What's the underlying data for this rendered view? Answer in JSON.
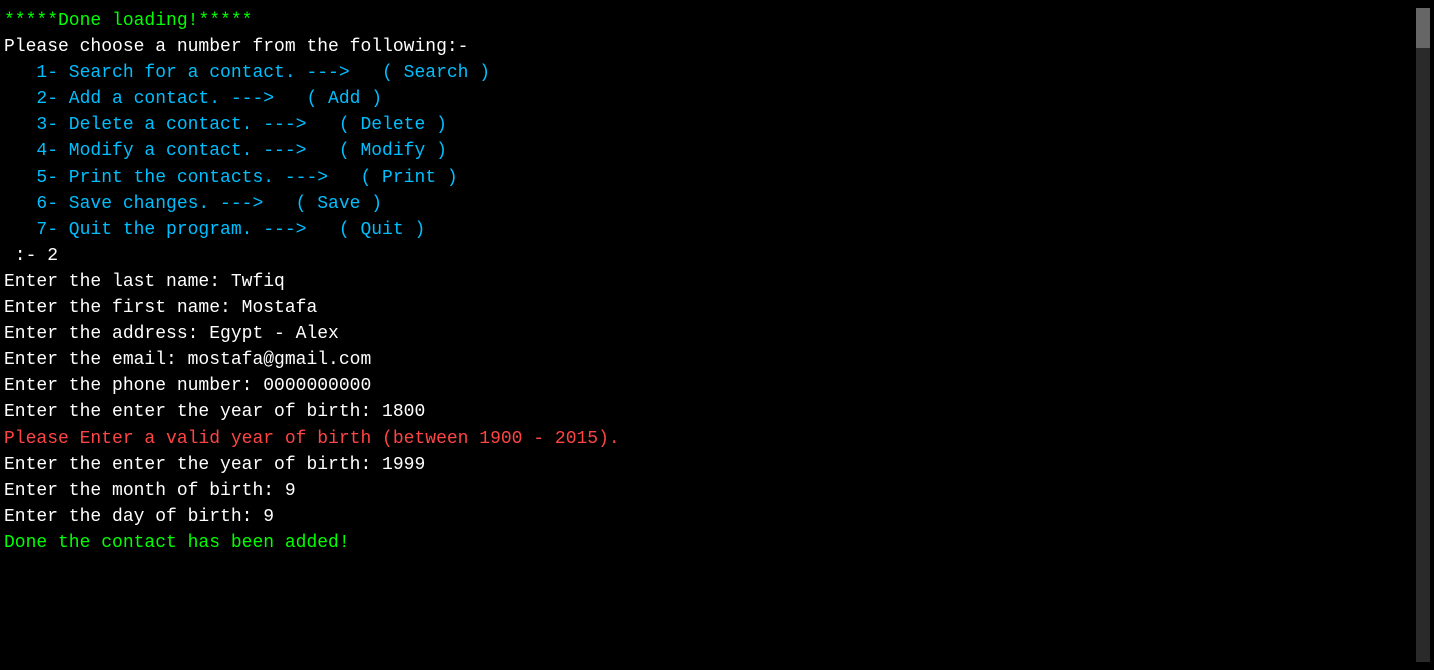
{
  "terminal": {
    "lines": [
      {
        "text": "*****Done loading!*****",
        "color": "green"
      },
      {
        "text": "Please choose a number from the following:-",
        "color": "white"
      },
      {
        "text": "   1- Search for a contact. --->   ( Search )",
        "color": "blue"
      },
      {
        "text": "   2- Add a contact. --->   ( Add )",
        "color": "blue"
      },
      {
        "text": "   3- Delete a contact. --->   ( Delete )",
        "color": "blue"
      },
      {
        "text": "   4- Modify a contact. --->   ( Modify )",
        "color": "blue"
      },
      {
        "text": "   5- Print the contacts. --->   ( Print )",
        "color": "blue"
      },
      {
        "text": "   6- Save changes. --->   ( Save )",
        "color": "blue"
      },
      {
        "text": "   7- Quit the program. --->   ( Quit )",
        "color": "blue"
      },
      {
        "text": "",
        "color": "white"
      },
      {
        "text": " :- 2",
        "color": "white"
      },
      {
        "text": "Enter the last name: Twfiq",
        "color": "white"
      },
      {
        "text": "Enter the first name: Mostafa",
        "color": "white"
      },
      {
        "text": "Enter the address: Egypt - Alex",
        "color": "white"
      },
      {
        "text": "Enter the email: mostafa@gmail.com",
        "color": "white"
      },
      {
        "text": "Enter the phone number: 0000000000",
        "color": "white"
      },
      {
        "text": "Enter the enter the year of birth: 1800",
        "color": "white"
      },
      {
        "text": "Please Enter a valid year of birth (between 1900 - 2015).",
        "color": "red"
      },
      {
        "text": "Enter the enter the year of birth: 1999",
        "color": "white"
      },
      {
        "text": "Enter the month of birth: 9",
        "color": "white"
      },
      {
        "text": "Enter the day of birth: 9",
        "color": "white"
      },
      {
        "text": "Done the contact has been added!",
        "color": "green"
      }
    ]
  }
}
